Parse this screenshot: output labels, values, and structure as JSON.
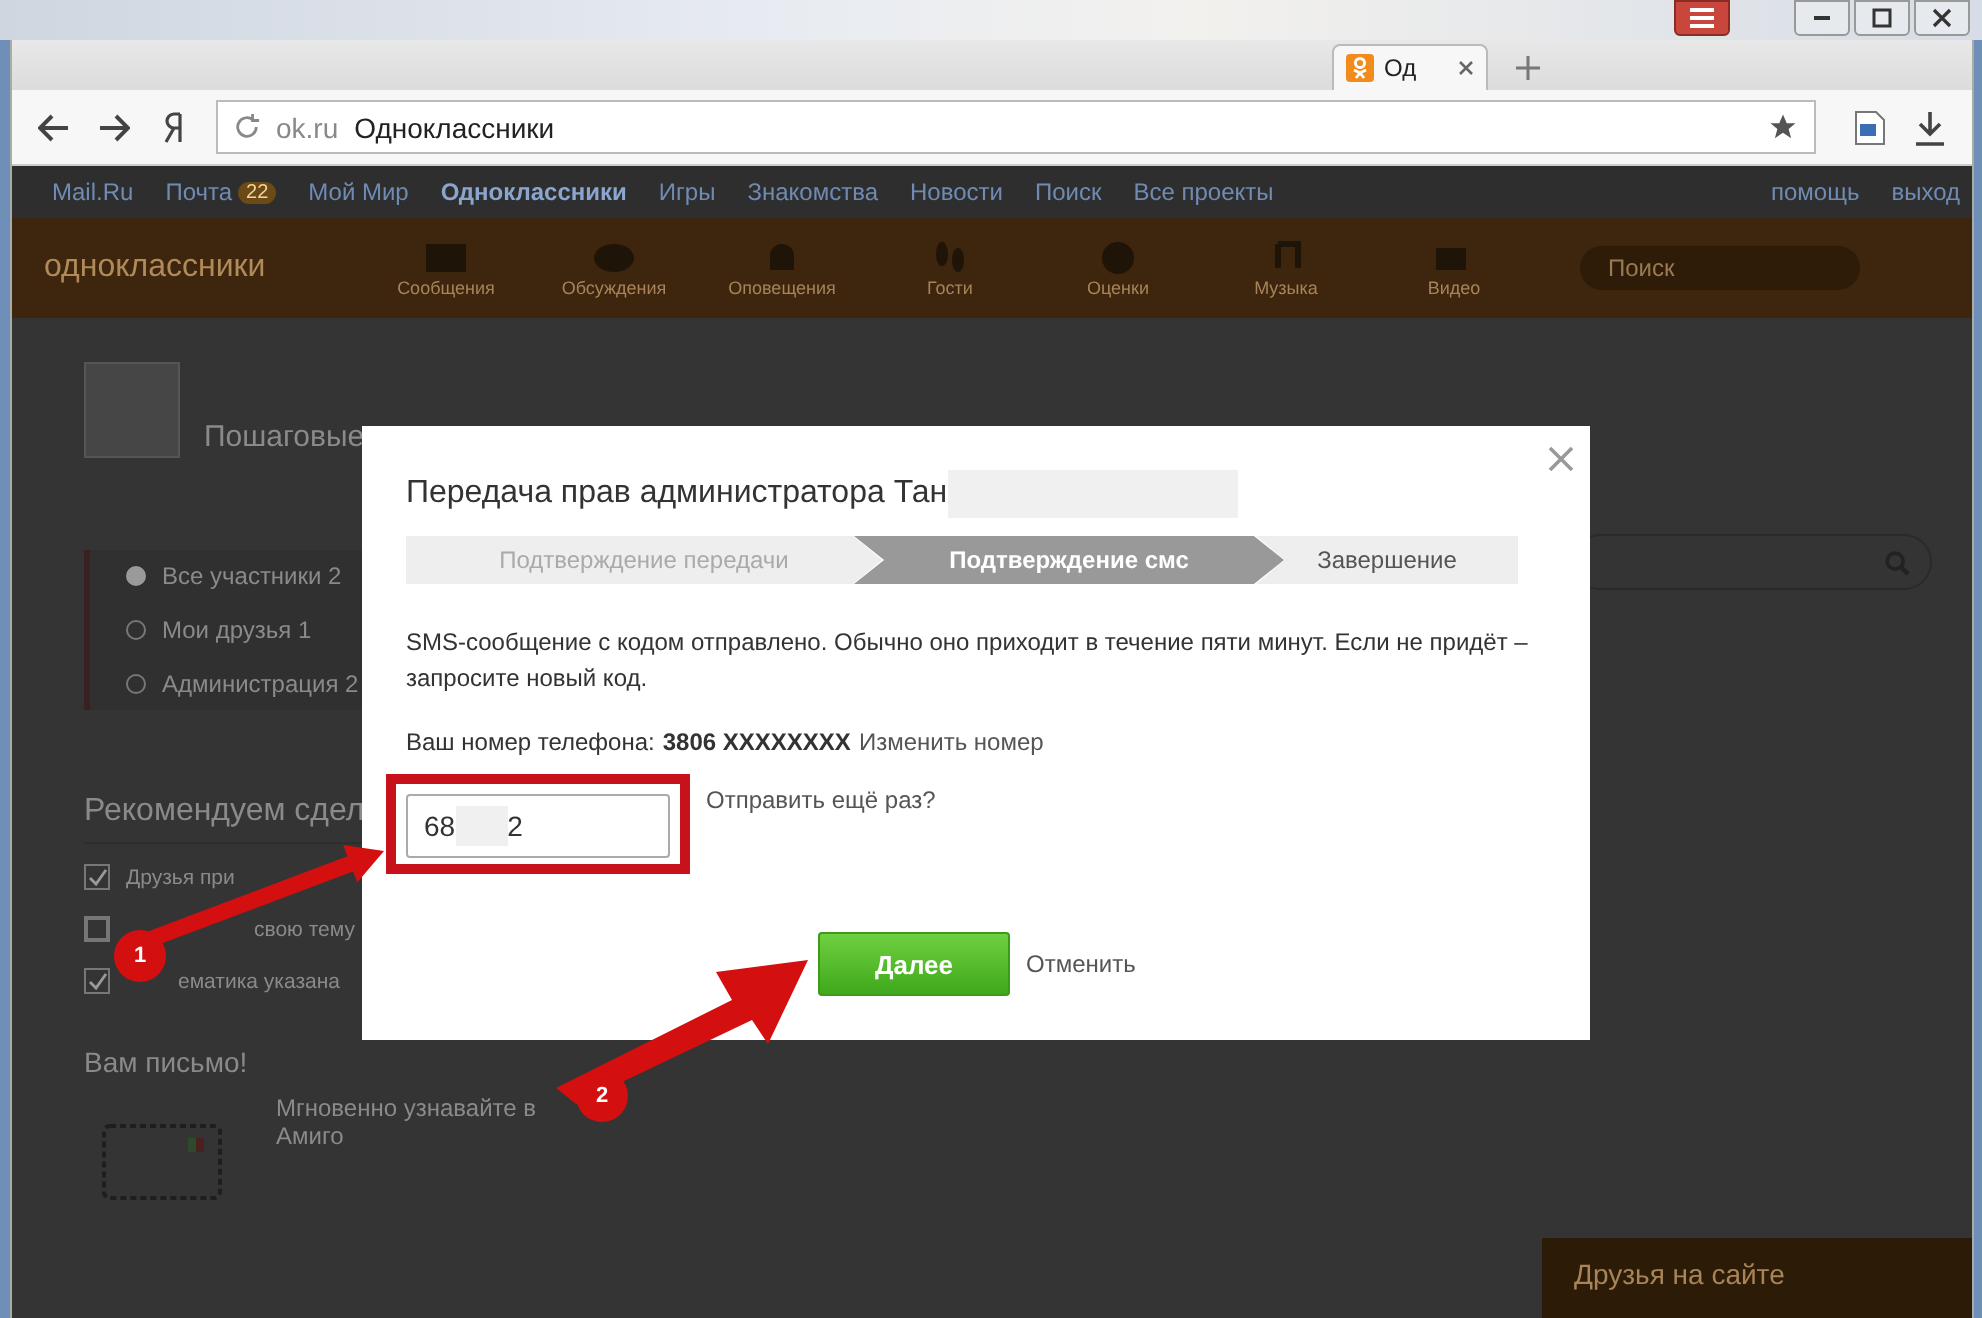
{
  "browser": {
    "tab_title": "Од",
    "address_domain": "ok.ru",
    "address_title": "Одноклассники"
  },
  "portal_nav": {
    "items": [
      {
        "label": "Mail.Ru",
        "selected": false
      },
      {
        "label": "Почта",
        "badge": "22",
        "selected": false
      },
      {
        "label": "Мой Мир",
        "selected": false
      },
      {
        "label": "Одноклассники",
        "selected": true
      },
      {
        "label": "Игры",
        "selected": false
      },
      {
        "label": "Знакомства",
        "selected": false
      },
      {
        "label": "Новости",
        "selected": false
      },
      {
        "label": "Поиск",
        "selected": false
      },
      {
        "label": "Все проекты",
        "selected": false
      }
    ],
    "right": [
      "помощь",
      "выход"
    ]
  },
  "site_header": {
    "logo": "одноклассники",
    "nav": [
      {
        "kind": "mail",
        "label": "Сообщения"
      },
      {
        "kind": "chat",
        "label": "Обсуждения"
      },
      {
        "kind": "bell",
        "label": "Оповещения"
      },
      {
        "kind": "steps",
        "label": "Гости"
      },
      {
        "kind": "rating",
        "label": "Оценки"
      },
      {
        "kind": "music",
        "label": "Музыка"
      },
      {
        "kind": "video",
        "label": "Видео"
      }
    ],
    "search_placeholder": "Поиск"
  },
  "group": {
    "title": "Пошаговые",
    "filters": [
      {
        "label": "Все участники",
        "count": "2",
        "selected": true
      },
      {
        "label": "Мои друзья",
        "count": "1",
        "selected": false
      },
      {
        "label": "Администрация",
        "count": "2",
        "selected": false
      }
    ]
  },
  "recommend": {
    "title": "Рекомендуем сдел",
    "items": [
      {
        "label": "Друзья при",
        "checked": true
      },
      {
        "label": "свою тему",
        "checked": false
      },
      {
        "label": "ематика указана",
        "checked": true
      }
    ]
  },
  "mail_promo": {
    "title": "Вам письмо!",
    "text": "Мгновенно узнавайте в Амиго"
  },
  "friends_panel": {
    "title": "Друзья на сайте"
  },
  "dialog": {
    "title": "Передача прав администратора Тан",
    "steps": [
      {
        "label": "Подтверждение передачи",
        "selected": false,
        "done": true
      },
      {
        "label": "Подтверждение смс",
        "selected": true,
        "done": false
      },
      {
        "label": "Завершение",
        "selected": false,
        "done": false
      }
    ],
    "message": "SMS-сообщение с кодом отправлено. Обычно оно приходит в течение пяти минут. Если не придёт – запросите новый код.",
    "phone_label": "Ваш номер телефона:",
    "phone_number": "3806 XXXXXXXX",
    "change_link": "Изменить номер",
    "code_parts": [
      "68",
      "2"
    ],
    "resend_link": "Отправить ещё раз?",
    "next_button": "Далее",
    "cancel_link": "Отменить"
  },
  "annotations": [
    {
      "number": "1"
    },
    {
      "number": "2"
    }
  ]
}
